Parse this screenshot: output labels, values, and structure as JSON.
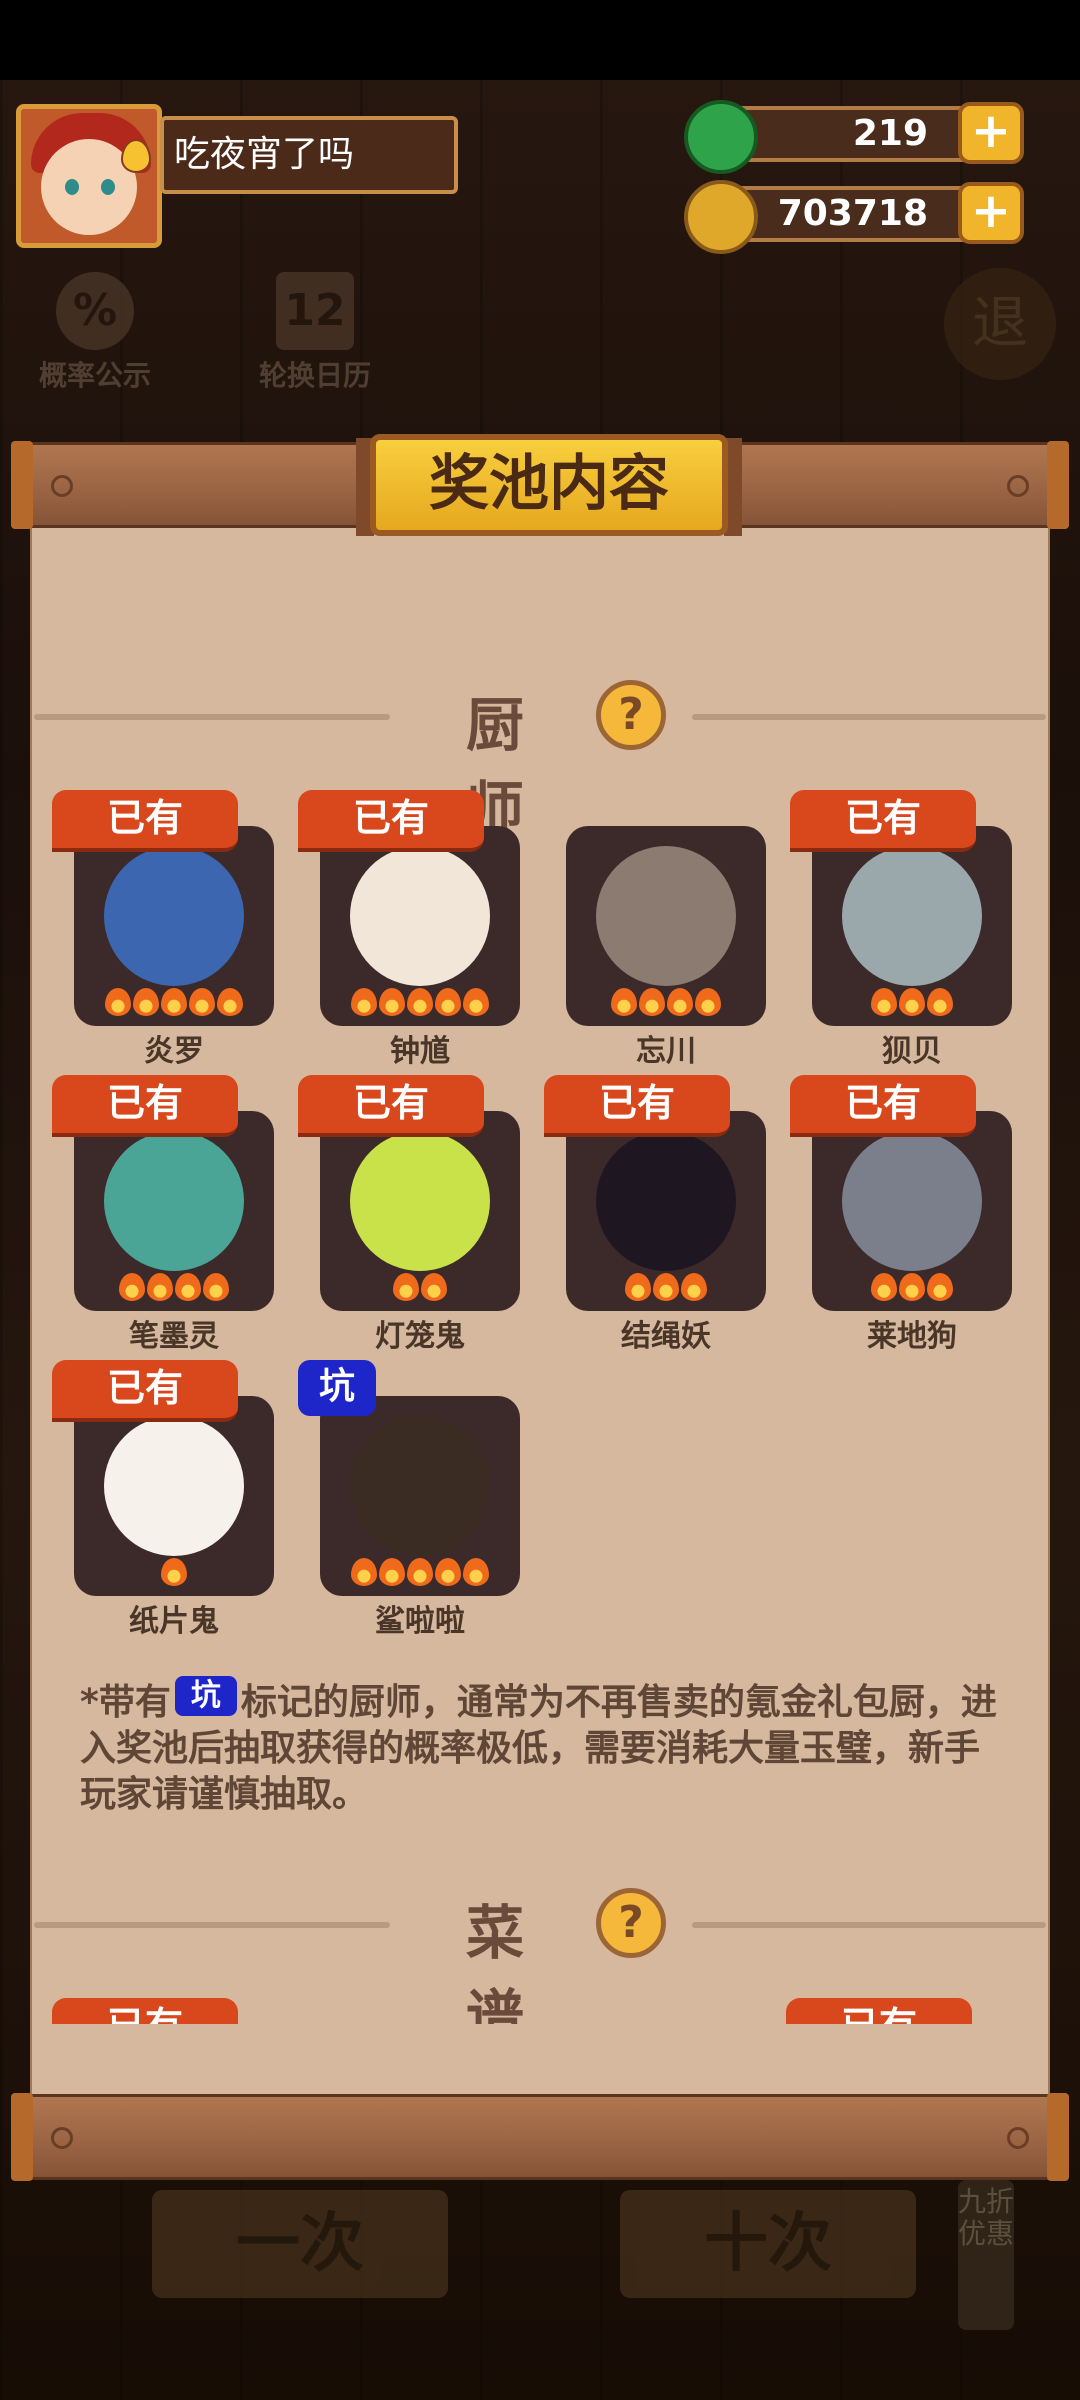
{
  "player": {
    "name": "吃夜宵了吗"
  },
  "resources": [
    {
      "name": "jade",
      "value": "219",
      "color": "#2ea34a"
    },
    {
      "name": "coin",
      "value": "703718",
      "color": "#e0a82a"
    }
  ],
  "side_tools": [
    {
      "label": "概率公示",
      "glyph": "%"
    },
    {
      "label": "轮换日历",
      "glyph": "12"
    }
  ],
  "exit_label": "退",
  "panel": {
    "title": "奖池内容",
    "chef_section": {
      "title": "厨师",
      "help": "?"
    },
    "recipe_section": {
      "title": "菜谱",
      "help": "?"
    },
    "owned_label": "已有",
    "pit_label": "坑",
    "chefs": [
      {
        "name": "炎罗",
        "owned": true,
        "pit": false,
        "stars": 5,
        "art_color": "#3c67b0"
      },
      {
        "name": "钟馗",
        "owned": true,
        "pit": false,
        "stars": 5,
        "art_color": "#f2e6d8"
      },
      {
        "name": "忘川",
        "owned": false,
        "pit": false,
        "stars": 4,
        "art_color": "#8c7b70"
      },
      {
        "name": "狈贝",
        "owned": true,
        "pit": false,
        "stars": 3,
        "art_color": "#9aa7ab"
      },
      {
        "name": "笔墨灵",
        "owned": true,
        "pit": false,
        "stars": 4,
        "art_color": "#4aa597"
      },
      {
        "name": "灯笼鬼",
        "owned": true,
        "pit": false,
        "stars": 2,
        "art_color": "#c9e24a"
      },
      {
        "name": "结绳妖",
        "owned": true,
        "pit": false,
        "stars": 3,
        "art_color": "#1e1620"
      },
      {
        "name": "莱地狗",
        "owned": true,
        "pit": false,
        "stars": 3,
        "art_color": "#7b7e8b"
      },
      {
        "name": "纸片鬼",
        "owned": true,
        "pit": false,
        "stars": 1,
        "art_color": "#f6f1ea"
      },
      {
        "name": "鲨啦啦",
        "owned": false,
        "pit": true,
        "stars": 5,
        "art_color": "#3a2c22"
      }
    ],
    "note": {
      "prefix": "*带有",
      "suffix": "标记的厨师，通常为不再售卖的氪金礼包厨，进入奖池后抽取获得的概率极低，需要消耗大量玉璧，新手玩家请谨慎抽取。"
    },
    "recipe_preview_tags": [
      "已有",
      "已有"
    ]
  },
  "background_buttons": [
    {
      "label": "一次"
    },
    {
      "label": "十次"
    }
  ],
  "promo_label": "九折优惠"
}
